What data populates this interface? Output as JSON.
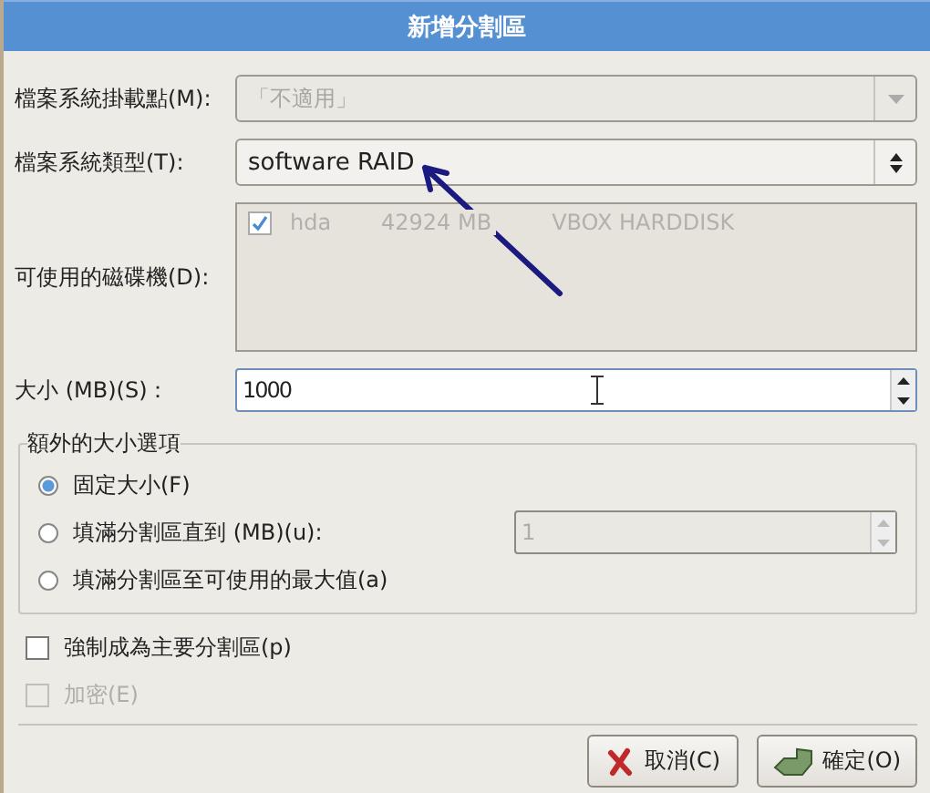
{
  "window": {
    "title": "新增分割區"
  },
  "mount_point": {
    "label": "檔案系統掛載點(M):",
    "value": "「不適用」",
    "disabled": true
  },
  "fs_type": {
    "label": "檔案系統類型(T):",
    "value": "software RAID"
  },
  "drives": {
    "label": "可使用的磁碟機(D):",
    "disabled": true,
    "items": [
      {
        "checked": true,
        "name": "hda",
        "size": "42924 MB",
        "model": "VBOX HARDDISK"
      }
    ]
  },
  "size": {
    "label": "大小 (MB)(S)：",
    "value": "1000"
  },
  "size_options": {
    "title": "額外的大小選項",
    "options": [
      {
        "label": "固定大小(F)",
        "selected": true
      },
      {
        "label": "填滿分割區直到 (MB)(u):",
        "selected": false,
        "spin_value": "1",
        "spin_disabled": true
      },
      {
        "label": "填滿分割區至可使用的最大值(a)",
        "selected": false
      }
    ]
  },
  "checkboxes": [
    {
      "label": "強制成為主要分割區(p)",
      "checked": false,
      "disabled": false
    },
    {
      "label": "加密(E)",
      "checked": false,
      "disabled": true
    }
  ],
  "buttons": [
    {
      "label": "取消(C)",
      "kind": "cancel"
    },
    {
      "label": "確定(O)",
      "kind": "ok"
    }
  ]
}
